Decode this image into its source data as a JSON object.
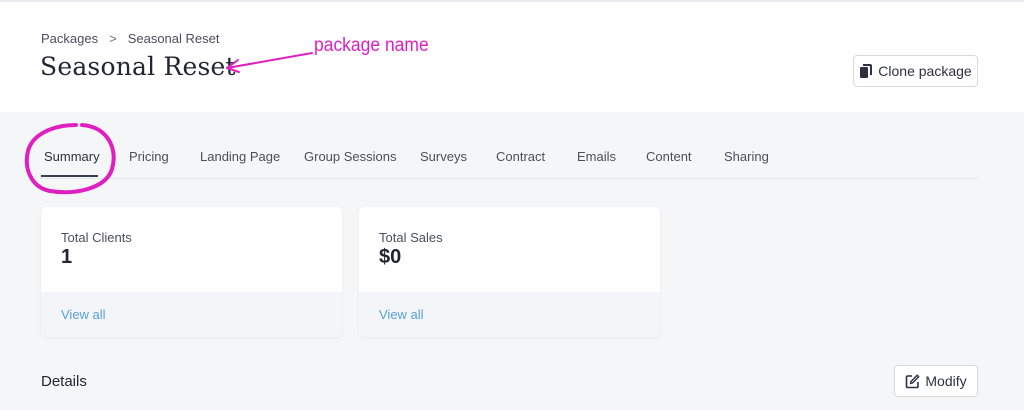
{
  "breadcrumb": {
    "items": [
      "Packages",
      "Seasonal Reset"
    ],
    "separator": ">"
  },
  "page": {
    "title": "Seasonal Reset"
  },
  "annotation": {
    "text": "package name",
    "color": "#e01fc0"
  },
  "actions": {
    "clone_label": "Clone package",
    "modify_label": "Modify"
  },
  "tabs": [
    {
      "label": "Summary",
      "active": true
    },
    {
      "label": "Pricing"
    },
    {
      "label": "Landing Page"
    },
    {
      "label": "Group Sessions"
    },
    {
      "label": "Surveys"
    },
    {
      "label": "Contract"
    },
    {
      "label": "Emails"
    },
    {
      "label": "Content"
    },
    {
      "label": "Sharing"
    }
  ],
  "cards": [
    {
      "label": "Total Clients",
      "value": "1",
      "link": "View all"
    },
    {
      "label": "Total Sales",
      "value": "$0",
      "link": "View all"
    }
  ],
  "details": {
    "title": "Details"
  },
  "colors": {
    "link": "#5aa0d8",
    "annotation": "#e01fc0",
    "background": "#f5f6f8"
  },
  "icons": {
    "clone": "copy-icon",
    "modify": "edit-icon"
  }
}
